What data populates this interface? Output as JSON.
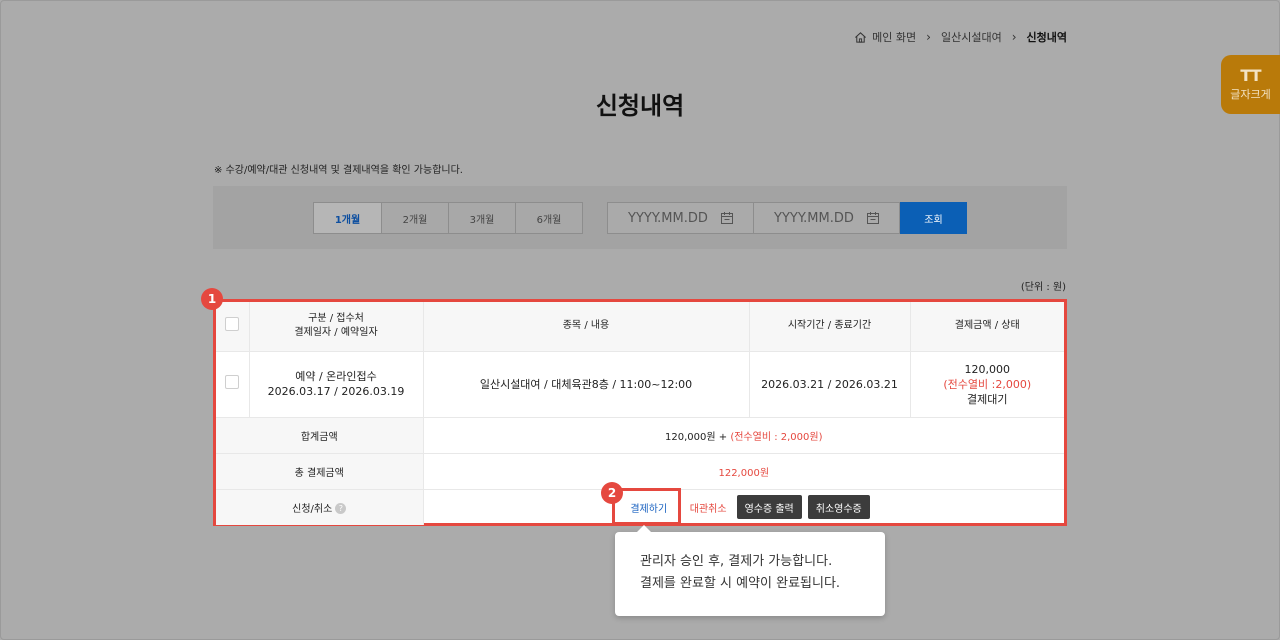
{
  "breadcrumb": {
    "home": "메인 화면",
    "section": "일산시설대여",
    "current": "신청내역"
  },
  "font_size_button": {
    "icon": "TT",
    "label": "글자크게"
  },
  "page_title": "신청내역",
  "notice": "※ 수강/예약/대관 신청내역 및 결제내역을 확인 가능합니다.",
  "filter": {
    "period_tabs": [
      "1개월",
      "2개월",
      "3개월",
      "6개월"
    ],
    "active_tab": "1개월",
    "start_date_placeholder": "YYYY.MM.DD",
    "end_date_placeholder": "YYYY.MM.DD",
    "search_label": "조회"
  },
  "unit_label": "(단위 : 원)",
  "table": {
    "headers": {
      "type_line1": "구분 /  접수처",
      "type_line2": "결제일자 / 예약일자",
      "item": "종목 / 내용",
      "period": "시작기간 / 종료기간",
      "amount": "결제금액 / 상태"
    },
    "row": {
      "type": "예약 / 온라인접수",
      "dates": "2026.03.17 / 2026.03.19",
      "item": "일산시설대여 / 대체육관8층 / 11:00~12:00",
      "period": "2026.03.21 /  2026.03.21",
      "amount": "120,000",
      "amount_extra": "(전수열비 :2,000)",
      "status": "결제대기"
    },
    "sum_label": "합계금액",
    "sum_value": "120,000원 + ",
    "sum_extra": "(전수열비 : 2,000원)",
    "total_label": "총 결제금액",
    "total_value": "122,000원",
    "apply_label": "신청/취소",
    "actions": {
      "pay": "결제하기",
      "cancel": "대관취소",
      "receipt": "영수증 출력",
      "cancel_receipt": "취소영수증"
    }
  },
  "markers": [
    "1",
    "2"
  ],
  "tooltip": {
    "line1": "관리자 승인 후, 결제가 가능합니다.",
    "line2": "결제를 완료할 시 예약이 완료됩니다."
  },
  "colors": {
    "accent_red": "#e5483f",
    "button_blue": "#0b5fb5",
    "font_button": "#b97a0a"
  }
}
